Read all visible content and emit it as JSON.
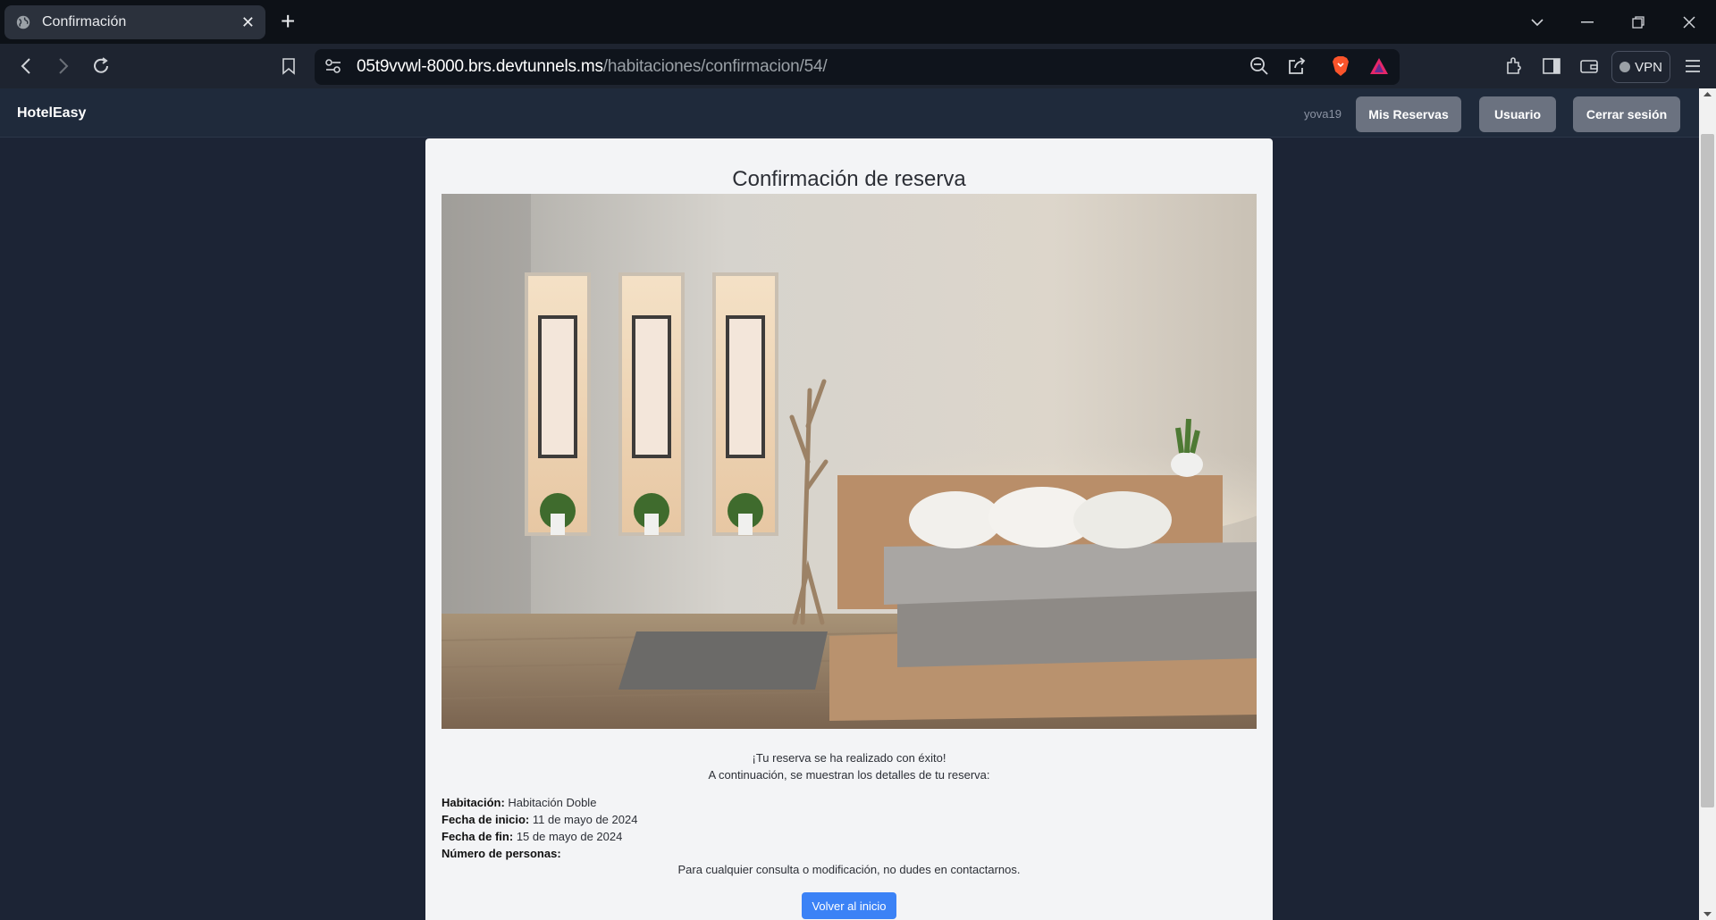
{
  "browser": {
    "tab_title": "Confirmación",
    "url_host": "05t9vvwl-8000.brs.devtunnels.ms",
    "url_path": "/habitaciones/confirmacion/54/",
    "vpn_label": "VPN"
  },
  "navbar": {
    "brand": "HotelEasy",
    "username": "yova19",
    "buttons": {
      "reservations": "Mis Reservas",
      "user": "Usuario",
      "logout": "Cerrar sesión"
    }
  },
  "confirmation": {
    "title": "Confirmación de reserva",
    "success_message": "¡Tu reserva se ha realizado con éxito!",
    "details_intro": "A continuación, se muestran los detalles de tu reserva:",
    "details": [
      {
        "label": "Habitación:",
        "value": "Habitación Doble"
      },
      {
        "label": "Fecha de inicio:",
        "value": "11 de mayo de 2024"
      },
      {
        "label": "Fecha de fin:",
        "value": "15 de mayo de 2024"
      },
      {
        "label": "Número de personas:",
        "value": ""
      }
    ],
    "contact_message": "Para cualquier consulta o modificación, no dudes en contactarnos.",
    "back_button": "Volver al inicio"
  },
  "colors": {
    "page_bg": "#1c2435",
    "navbar_bg": "#1f2a3b",
    "nav_button": "#6b7280",
    "card_bg": "#f3f4f6",
    "primary": "#3b82f6"
  }
}
